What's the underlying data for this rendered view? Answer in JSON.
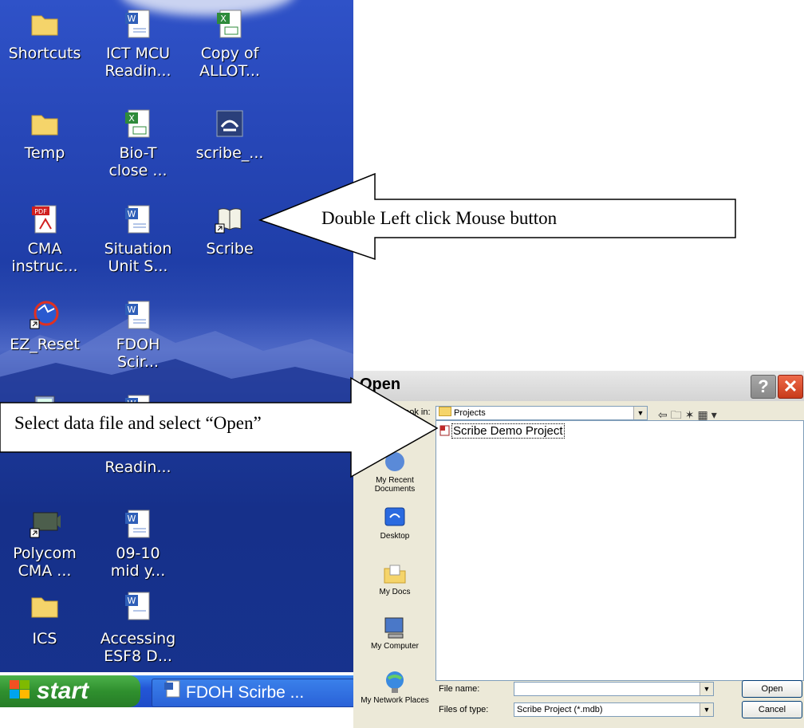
{
  "desktop": {
    "icons": [
      {
        "label1": "Shortcuts",
        "label2": "",
        "icon": "folder-icon"
      },
      {
        "label1": "ICT MCU",
        "label2": "Readin...",
        "icon": "word-doc-icon"
      },
      {
        "label1": "Copy of",
        "label2": "ALLOT...",
        "icon": "excel-doc-icon"
      },
      {
        "label1": "Temp",
        "label2": "",
        "icon": "folder-icon"
      },
      {
        "label1": "Bio-T",
        "label2": "close ...",
        "icon": "excel-doc-icon"
      },
      {
        "label1": "scribe_...",
        "label2": "",
        "icon": "setup-icon"
      },
      {
        "label1": "CMA",
        "label2": "instruc...",
        "icon": "pdf-icon"
      },
      {
        "label1": "Situation",
        "label2": "Unit S...",
        "icon": "word-doc-icon"
      },
      {
        "label1": "Scribe",
        "label2": "",
        "icon": "book-shortcut-icon"
      },
      {
        "label1": "EZ_Reset",
        "label2": "",
        "icon": "ez-reset-icon"
      },
      {
        "label1": "FDOH",
        "label2": "Scir...",
        "icon": "word-doc-icon"
      },
      {
        "label1": "",
        "label2": "",
        "icon": "calculator-icon"
      },
      {
        "label1": "Readin...",
        "label2": "",
        "icon": "word-doc-icon"
      },
      {
        "label1": "Polycom",
        "label2": "CMA ...",
        "icon": "polycom-icon"
      },
      {
        "label1": "09-10",
        "label2": "mid y...",
        "icon": "word-doc-icon"
      },
      {
        "label1": "ICS",
        "label2": "",
        "icon": "folder-icon"
      },
      {
        "label1": "Accessing",
        "label2": "ESF8 D...",
        "icon": "word-doc-icon"
      }
    ]
  },
  "taskbar": {
    "start_label": "start",
    "task_label": "FDOH Scirbe ..."
  },
  "dialog": {
    "title": "Open",
    "help_glyph": "?",
    "close_glyph": "✕",
    "look_in_label": "Look in:",
    "look_in_value": "Projects",
    "places": [
      {
        "label": "My Recent Documents",
        "icon": "recent-docs-icon"
      },
      {
        "label": "Desktop",
        "icon": "desktop-icon"
      },
      {
        "label": "My Docs",
        "icon": "my-docs-icon"
      },
      {
        "label": "My Computer",
        "icon": "my-computer-icon"
      },
      {
        "label": "My Network Places",
        "icon": "network-places-icon"
      }
    ],
    "files": [
      {
        "name": "Scribe Demo Project",
        "icon": "access-db-icon"
      }
    ],
    "file_name_label": "File name:",
    "file_name_value": "",
    "files_of_type_label": "Files of type:",
    "files_of_type_value": "Scribe Project (*.mdb)",
    "open_button": "Open",
    "cancel_button": "Cancel"
  },
  "callouts": {
    "top": "Double Left click Mouse button",
    "middle": "Select data file and select “Open”"
  }
}
